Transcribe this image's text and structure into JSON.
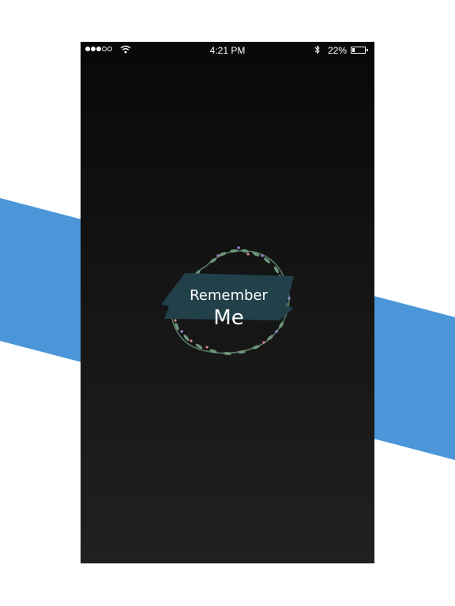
{
  "status_bar": {
    "signal_bars": 3,
    "signal_max": 5,
    "time": "4:21 PM",
    "battery_percent_label": "22%",
    "battery_level": 0.22
  },
  "logo": {
    "line1": "Remember",
    "line2": "Me"
  },
  "colors": {
    "accent_band": "#4a96d8",
    "screen_top": "#080808",
    "screen_bottom": "#202020",
    "banner": "#21404a"
  },
  "icons": [
    "wifi-icon",
    "bluetooth-icon",
    "battery-icon"
  ]
}
